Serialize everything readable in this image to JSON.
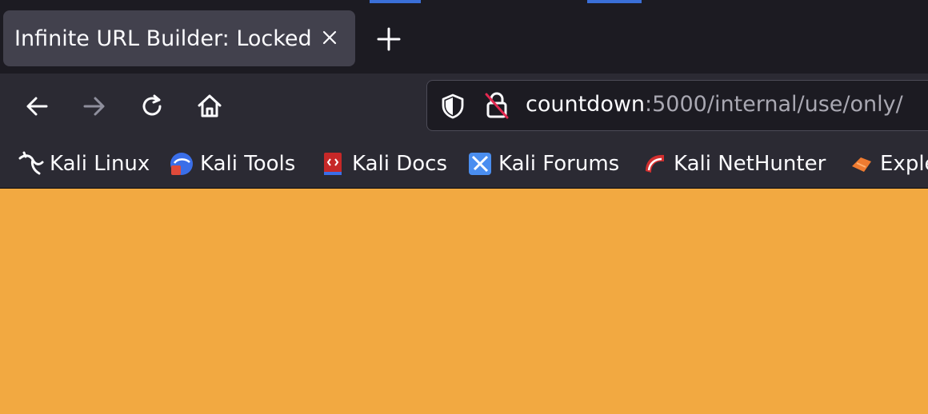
{
  "tab": {
    "title": "Infinite URL Builder: Locked"
  },
  "urlbar": {
    "host": "countdown",
    "rest": ":5000/internal/use/only/"
  },
  "bookmarks": [
    {
      "label": "Kali Linux",
      "icon": "kali-dragon-icon"
    },
    {
      "label": "Kali Tools",
      "icon": "kali-tools-icon"
    },
    {
      "label": "Kali Docs",
      "icon": "kali-docs-icon"
    },
    {
      "label": "Kali Forums",
      "icon": "kali-forums-icon"
    },
    {
      "label": "Kali NetHunter",
      "icon": "kali-nethunter-icon"
    },
    {
      "label": "Exple",
      "icon": "exploit-db-icon"
    }
  ],
  "colors": {
    "page_background": "#f2a941",
    "toolbar": "#2b2a33",
    "tabbar": "#1c1b22"
  }
}
